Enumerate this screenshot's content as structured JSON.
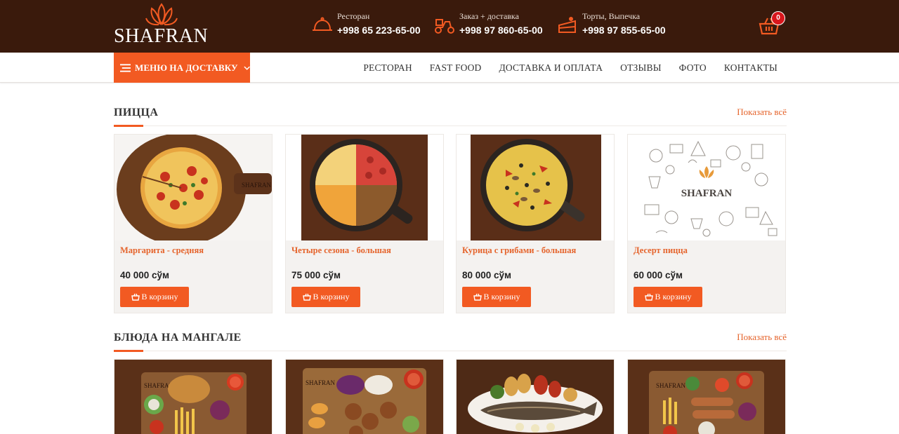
{
  "brand": {
    "name": "SHAFRAN"
  },
  "header": {
    "contacts": [
      {
        "label": "Ресторан",
        "phone": "+998 65 223-65-00",
        "icon": "cloche-icon"
      },
      {
        "label": "Заказ + доставка",
        "phone": "+998 97 860-65-00",
        "icon": "delivery-scooter-icon"
      },
      {
        "label": "Торты, Выпечка",
        "phone": "+998 97 855-65-00",
        "icon": "cake-slice-icon"
      }
    ],
    "cart": {
      "count": "0",
      "icon": "cart-basket-icon"
    }
  },
  "nav": {
    "menu_button": "МЕНЮ НА ДОСТАВКУ",
    "links": [
      "РЕСТОРАН",
      "FAST FOOD",
      "ДОСТАВКА И ОПЛАТА",
      "ОТЗЫВЫ",
      "ФОТО",
      "КОНТАКТЫ"
    ]
  },
  "sections": [
    {
      "title": "ПИЦЦА",
      "show_all": "Показать всё",
      "products": [
        {
          "name": "Маргарита - средняя",
          "price": "40 000 сўм",
          "button": "В корзину",
          "image": "margherita-pizza"
        },
        {
          "name": "Четыре сезона - большая",
          "price": "75 000 сўм",
          "button": "В корзину",
          "image": "four-seasons-pizza"
        },
        {
          "name": "Курица с грибами - большая",
          "price": "80 000 сўм",
          "button": "В корзину",
          "image": "chicken-mushroom-pizza"
        },
        {
          "name": "Десерт пицца",
          "price": "60 000 сўм",
          "button": "В корзину",
          "image": "shafran-placeholder"
        }
      ]
    },
    {
      "title": "БЛЮДА НА МАНГАЛЕ",
      "show_all": "Показать всё",
      "products": [
        {
          "image": "grill-platter-fries"
        },
        {
          "image": "grill-platter-mixed"
        },
        {
          "image": "grilled-fish"
        },
        {
          "image": "grill-platter-sausages"
        }
      ]
    }
  ],
  "colors": {
    "header_bg": "#3a1a0c",
    "accent": "#f25a22",
    "badge": "#d9161c"
  }
}
